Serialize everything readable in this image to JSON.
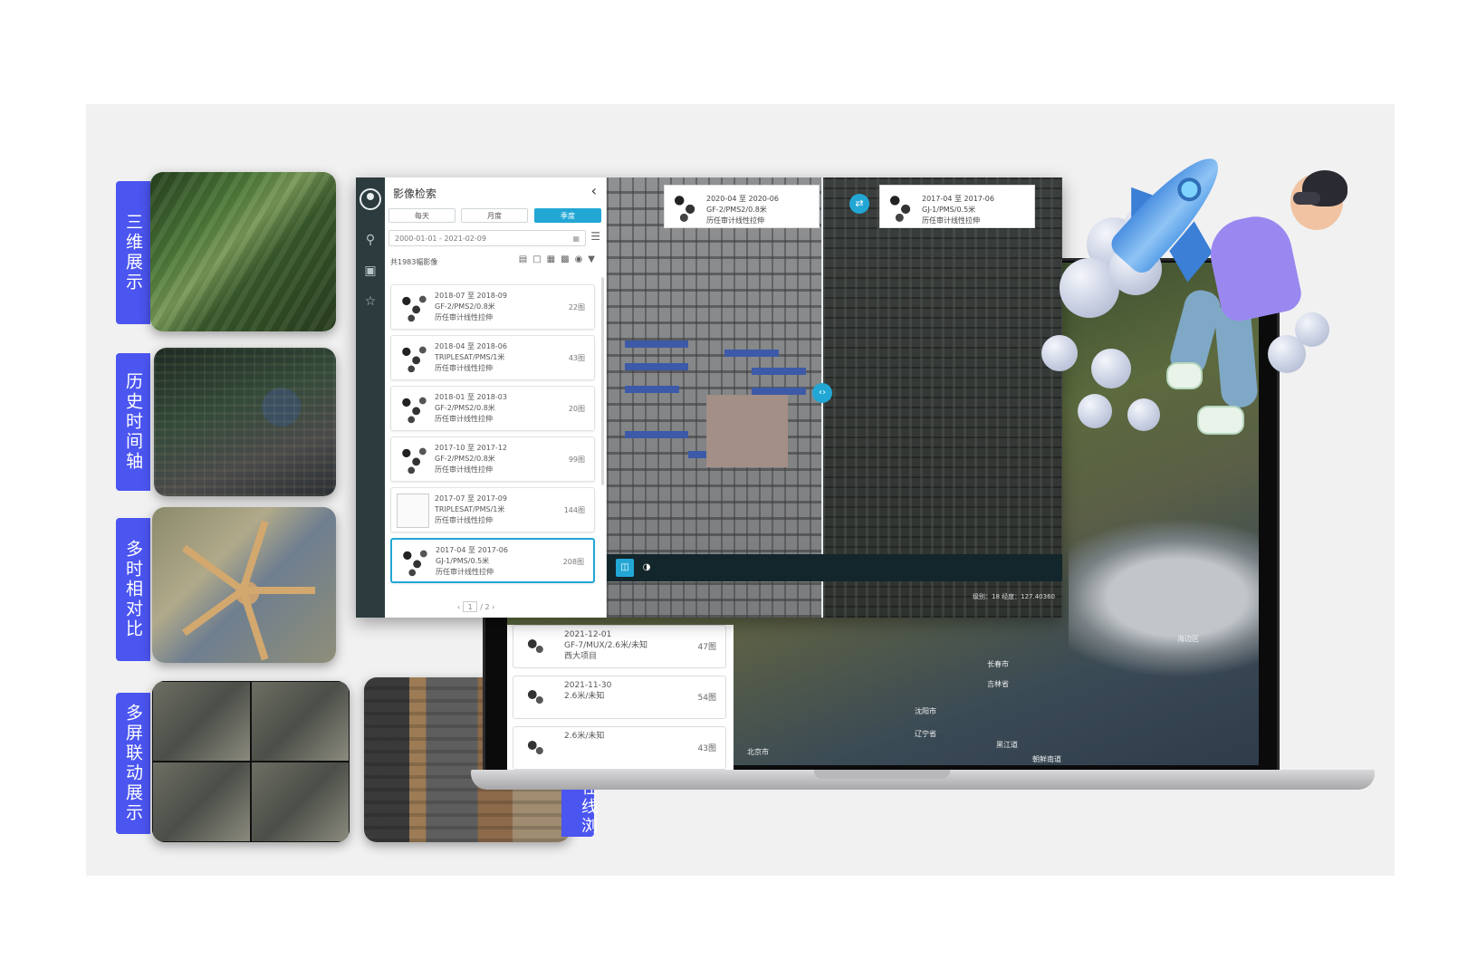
{
  "features": [
    {
      "label": "三维展示"
    },
    {
      "label": "历史时间轴"
    },
    {
      "label": "多时相对比"
    },
    {
      "label": "多屏联动展示"
    },
    {
      "label": "无人机影像在线浏览"
    }
  ],
  "panel": {
    "title": "影像检索",
    "tabs": [
      "每天",
      "月度",
      "季度"
    ],
    "active_tab": "季度",
    "date_range": "2000-01-01 - 2021-02-09",
    "result_count": "共1983幅影像",
    "items": [
      {
        "period": "2018-07 至 2018-09",
        "sensor": "GF-2/PMS2/0.8米",
        "note": "历任审计线性拉伸",
        "count": "22图"
      },
      {
        "period": "2018-04 至 2018-06",
        "sensor": "TRIPLESAT/PMS/1米",
        "note": "历任审计线性拉伸",
        "count": "43图"
      },
      {
        "period": "2018-01 至 2018-03",
        "sensor": "GF-2/PMS2/0.8米",
        "note": "历任审计线性拉伸",
        "count": "20图"
      },
      {
        "period": "2017-10 至 2017-12",
        "sensor": "GF-2/PMS2/0.8米",
        "note": "历任审计线性拉伸",
        "count": "99图"
      },
      {
        "period": "2017-07 至 2017-09",
        "sensor": "TRIPLESAT/PMS/1米",
        "note": "历任审计线性拉伸",
        "count": "144图"
      },
      {
        "period": "2017-04 至 2017-06",
        "sensor": "GJ-1/PMS/0.5米",
        "note": "历任审计线性拉伸",
        "count": "208图"
      }
    ],
    "pager": {
      "current": "1",
      "sep": "/",
      "total": "2"
    }
  },
  "compare": {
    "left": {
      "period": "2020-04 至 2020-06",
      "sensor": "GF-2/PMS2/0.8米",
      "note": "历任审计线性拉伸"
    },
    "right": {
      "period": "2017-04 至 2017-06",
      "sensor": "GJ-1/PMS/0.5米",
      "note": "历任审计线性拉伸"
    },
    "status": "级别：18  经度：127.40360"
  },
  "laptop": {
    "items": [
      {
        "period": "2021-12-01",
        "sensor": "GF-7/MUX/2.6米/未知",
        "note": "西大项目",
        "count": "47图"
      },
      {
        "period": "2021-11-30",
        "sensor": "2.6米/未知",
        "note": "",
        "count": "54图"
      },
      {
        "period": "",
        "sensor": "2.6米/未知",
        "note": "",
        "count": "43图"
      }
    ],
    "map_labels": [
      "长春市",
      "吉林省",
      "沈阳市",
      "辽宁省",
      "北京市",
      "黑江道",
      "海边区",
      "朝鲜南道"
    ]
  },
  "colors": {
    "accent": "#22a7d5",
    "feature_label": "#4b55f0",
    "nav": "#2c3b3e"
  }
}
